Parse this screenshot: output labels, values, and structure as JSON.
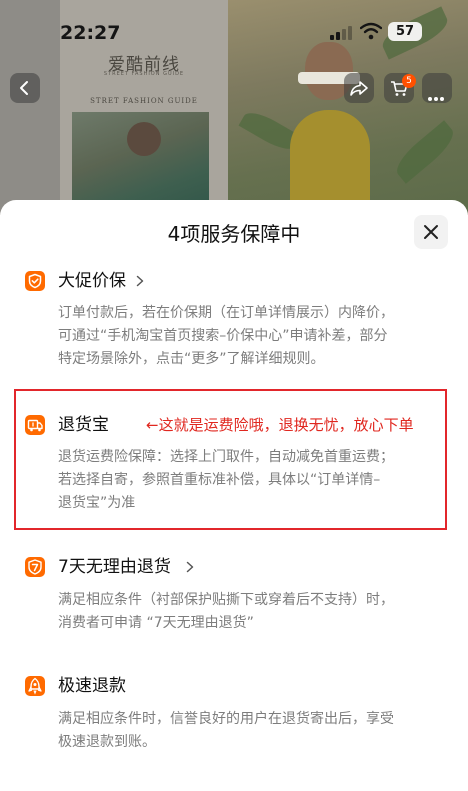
{
  "status_bar": {
    "time": "22:27",
    "battery": "57",
    "icons": [
      "signal-icon",
      "wifi-icon",
      "battery-icon"
    ]
  },
  "background": {
    "brand_name": "爱酷前线",
    "brand_sub": "STREET FASHION GUIDE",
    "guide_title": "STRET FASHION GUIDE",
    "cart_badge": "5",
    "icons": [
      "back-icon",
      "share-icon",
      "cart-icon",
      "more-icon"
    ]
  },
  "sheet": {
    "title": "4项服务保障中",
    "close_icon": "close-icon",
    "sections": [
      {
        "icon": "price-protect-icon",
        "title": "大促价保",
        "has_chevron": true,
        "lines": [
          "订单付款后，若在价保期（在订单详情展示）内降价，",
          "可通过“手机淘宝首页搜索–价保中心”申请补差，部分",
          "特定场景除外，点击“更多”了解详细规则。"
        ]
      },
      {
        "icon": "return-insurance-icon",
        "title": "退货宝",
        "annotation": "←这就是运费险哦，退换无忧，放心下单",
        "has_chevron": false,
        "lines": [
          "退货运费险保障：选择上门取件，自动减免首重运费；",
          "若选择自寄，参照首重标准补偿，具体以“订单详情–",
          "退货宝”为准"
        ]
      },
      {
        "icon": "seven-day-return-icon",
        "title": "7天无理由退货",
        "has_chevron": true,
        "lines": [
          "满足相应条件（衬部保护贴撕下或穿着后不支持）时，",
          "消费者可申请 “7天无理由退货”"
        ]
      },
      {
        "icon": "fast-refund-icon",
        "title": "极速退款",
        "has_chevron": false,
        "lines": [
          "满足相应条件时，信誉良好的用户在退货寄出后，享受",
          "极速退款到账。"
        ]
      }
    ]
  },
  "colors": {
    "accent_orange": "#ff6a00",
    "annotation_red": "#e0271f",
    "body_text": "#7d7d7d"
  }
}
